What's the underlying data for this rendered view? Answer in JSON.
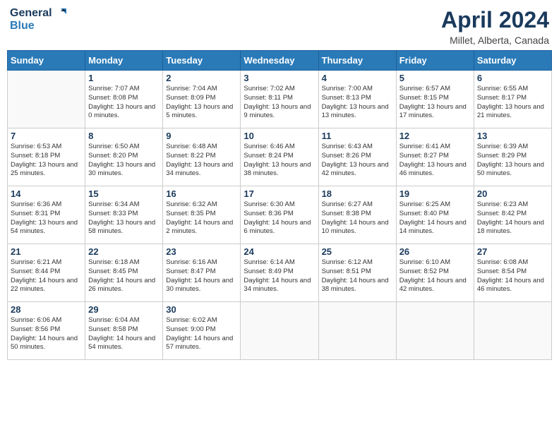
{
  "header": {
    "logo_line1": "General",
    "logo_line2": "Blue",
    "month_title": "April 2024",
    "location": "Millet, Alberta, Canada"
  },
  "weekdays": [
    "Sunday",
    "Monday",
    "Tuesday",
    "Wednesday",
    "Thursday",
    "Friday",
    "Saturday"
  ],
  "weeks": [
    [
      {
        "day": "",
        "sunrise": "",
        "sunset": "",
        "daylight": ""
      },
      {
        "day": "1",
        "sunrise": "Sunrise: 7:07 AM",
        "sunset": "Sunset: 8:08 PM",
        "daylight": "Daylight: 13 hours and 0 minutes."
      },
      {
        "day": "2",
        "sunrise": "Sunrise: 7:04 AM",
        "sunset": "Sunset: 8:09 PM",
        "daylight": "Daylight: 13 hours and 5 minutes."
      },
      {
        "day": "3",
        "sunrise": "Sunrise: 7:02 AM",
        "sunset": "Sunset: 8:11 PM",
        "daylight": "Daylight: 13 hours and 9 minutes."
      },
      {
        "day": "4",
        "sunrise": "Sunrise: 7:00 AM",
        "sunset": "Sunset: 8:13 PM",
        "daylight": "Daylight: 13 hours and 13 minutes."
      },
      {
        "day": "5",
        "sunrise": "Sunrise: 6:57 AM",
        "sunset": "Sunset: 8:15 PM",
        "daylight": "Daylight: 13 hours and 17 minutes."
      },
      {
        "day": "6",
        "sunrise": "Sunrise: 6:55 AM",
        "sunset": "Sunset: 8:17 PM",
        "daylight": "Daylight: 13 hours and 21 minutes."
      }
    ],
    [
      {
        "day": "7",
        "sunrise": "Sunrise: 6:53 AM",
        "sunset": "Sunset: 8:18 PM",
        "daylight": "Daylight: 13 hours and 25 minutes."
      },
      {
        "day": "8",
        "sunrise": "Sunrise: 6:50 AM",
        "sunset": "Sunset: 8:20 PM",
        "daylight": "Daylight: 13 hours and 30 minutes."
      },
      {
        "day": "9",
        "sunrise": "Sunrise: 6:48 AM",
        "sunset": "Sunset: 8:22 PM",
        "daylight": "Daylight: 13 hours and 34 minutes."
      },
      {
        "day": "10",
        "sunrise": "Sunrise: 6:46 AM",
        "sunset": "Sunset: 8:24 PM",
        "daylight": "Daylight: 13 hours and 38 minutes."
      },
      {
        "day": "11",
        "sunrise": "Sunrise: 6:43 AM",
        "sunset": "Sunset: 8:26 PM",
        "daylight": "Daylight: 13 hours and 42 minutes."
      },
      {
        "day": "12",
        "sunrise": "Sunrise: 6:41 AM",
        "sunset": "Sunset: 8:27 PM",
        "daylight": "Daylight: 13 hours and 46 minutes."
      },
      {
        "day": "13",
        "sunrise": "Sunrise: 6:39 AM",
        "sunset": "Sunset: 8:29 PM",
        "daylight": "Daylight: 13 hours and 50 minutes."
      }
    ],
    [
      {
        "day": "14",
        "sunrise": "Sunrise: 6:36 AM",
        "sunset": "Sunset: 8:31 PM",
        "daylight": "Daylight: 13 hours and 54 minutes."
      },
      {
        "day": "15",
        "sunrise": "Sunrise: 6:34 AM",
        "sunset": "Sunset: 8:33 PM",
        "daylight": "Daylight: 13 hours and 58 minutes."
      },
      {
        "day": "16",
        "sunrise": "Sunrise: 6:32 AM",
        "sunset": "Sunset: 8:35 PM",
        "daylight": "Daylight: 14 hours and 2 minutes."
      },
      {
        "day": "17",
        "sunrise": "Sunrise: 6:30 AM",
        "sunset": "Sunset: 8:36 PM",
        "daylight": "Daylight: 14 hours and 6 minutes."
      },
      {
        "day": "18",
        "sunrise": "Sunrise: 6:27 AM",
        "sunset": "Sunset: 8:38 PM",
        "daylight": "Daylight: 14 hours and 10 minutes."
      },
      {
        "day": "19",
        "sunrise": "Sunrise: 6:25 AM",
        "sunset": "Sunset: 8:40 PM",
        "daylight": "Daylight: 14 hours and 14 minutes."
      },
      {
        "day": "20",
        "sunrise": "Sunrise: 6:23 AM",
        "sunset": "Sunset: 8:42 PM",
        "daylight": "Daylight: 14 hours and 18 minutes."
      }
    ],
    [
      {
        "day": "21",
        "sunrise": "Sunrise: 6:21 AM",
        "sunset": "Sunset: 8:44 PM",
        "daylight": "Daylight: 14 hours and 22 minutes."
      },
      {
        "day": "22",
        "sunrise": "Sunrise: 6:18 AM",
        "sunset": "Sunset: 8:45 PM",
        "daylight": "Daylight: 14 hours and 26 minutes."
      },
      {
        "day": "23",
        "sunrise": "Sunrise: 6:16 AM",
        "sunset": "Sunset: 8:47 PM",
        "daylight": "Daylight: 14 hours and 30 minutes."
      },
      {
        "day": "24",
        "sunrise": "Sunrise: 6:14 AM",
        "sunset": "Sunset: 8:49 PM",
        "daylight": "Daylight: 14 hours and 34 minutes."
      },
      {
        "day": "25",
        "sunrise": "Sunrise: 6:12 AM",
        "sunset": "Sunset: 8:51 PM",
        "daylight": "Daylight: 14 hours and 38 minutes."
      },
      {
        "day": "26",
        "sunrise": "Sunrise: 6:10 AM",
        "sunset": "Sunset: 8:52 PM",
        "daylight": "Daylight: 14 hours and 42 minutes."
      },
      {
        "day": "27",
        "sunrise": "Sunrise: 6:08 AM",
        "sunset": "Sunset: 8:54 PM",
        "daylight": "Daylight: 14 hours and 46 minutes."
      }
    ],
    [
      {
        "day": "28",
        "sunrise": "Sunrise: 6:06 AM",
        "sunset": "Sunset: 8:56 PM",
        "daylight": "Daylight: 14 hours and 50 minutes."
      },
      {
        "day": "29",
        "sunrise": "Sunrise: 6:04 AM",
        "sunset": "Sunset: 8:58 PM",
        "daylight": "Daylight: 14 hours and 54 minutes."
      },
      {
        "day": "30",
        "sunrise": "Sunrise: 6:02 AM",
        "sunset": "Sunset: 9:00 PM",
        "daylight": "Daylight: 14 hours and 57 minutes."
      },
      {
        "day": "",
        "sunrise": "",
        "sunset": "",
        "daylight": ""
      },
      {
        "day": "",
        "sunrise": "",
        "sunset": "",
        "daylight": ""
      },
      {
        "day": "",
        "sunrise": "",
        "sunset": "",
        "daylight": ""
      },
      {
        "day": "",
        "sunrise": "",
        "sunset": "",
        "daylight": ""
      }
    ]
  ]
}
